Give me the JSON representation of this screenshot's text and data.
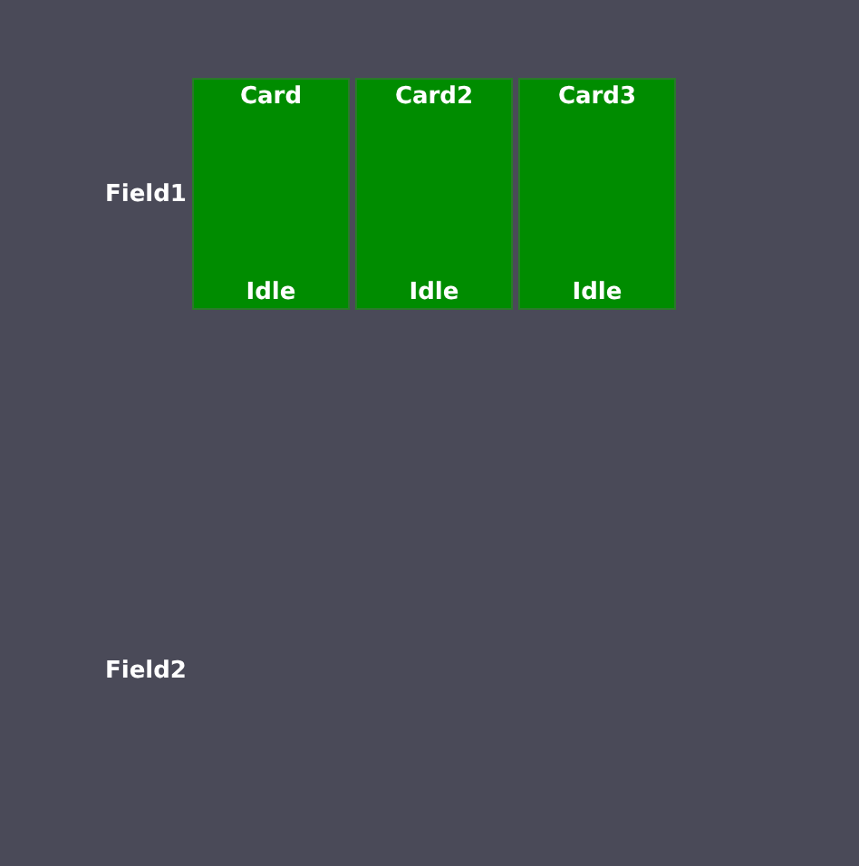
{
  "fields": [
    {
      "label": "Field1",
      "cards": [
        {
          "title": "Card",
          "status": "Idle"
        },
        {
          "title": "Card2",
          "status": "Idle"
        },
        {
          "title": "Card3",
          "status": "Idle"
        }
      ]
    },
    {
      "label": "Field2"
    }
  ]
}
